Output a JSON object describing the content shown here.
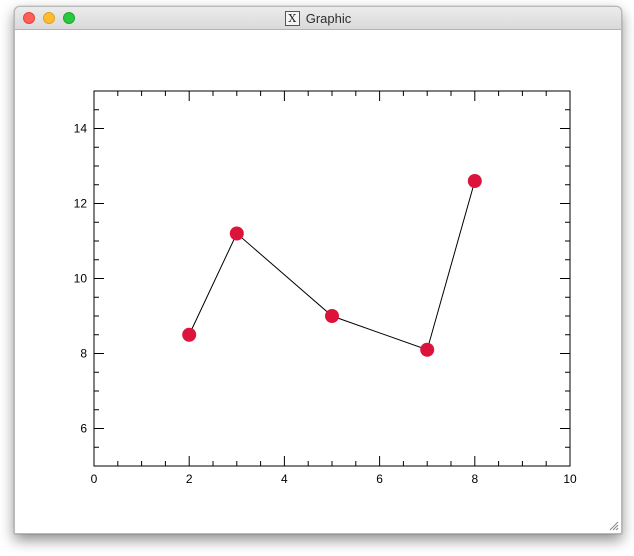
{
  "window": {
    "title": "Graphic",
    "icon": "x11-icon",
    "icon_glyph": "X"
  },
  "chart_data": {
    "type": "line",
    "x": [
      2,
      3,
      5,
      7,
      8
    ],
    "y": [
      8.5,
      11.2,
      9.0,
      8.1,
      12.6
    ],
    "xlim": [
      0,
      10
    ],
    "ylim": [
      5,
      15
    ],
    "x_ticks": [
      0,
      2,
      4,
      6,
      8,
      10
    ],
    "y_ticks": [
      6,
      8,
      10,
      12,
      14
    ],
    "title": "",
    "xlabel": "",
    "ylabel": "",
    "marker_color": "#dc143c",
    "line_color": "#000000",
    "grid": false
  }
}
